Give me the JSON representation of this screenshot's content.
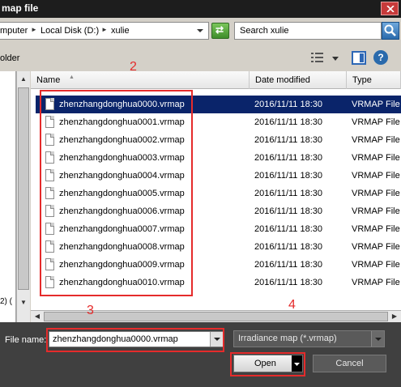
{
  "window": {
    "title": "map file"
  },
  "address": {
    "crumbs": [
      "mputer",
      "Local Disk (D:)",
      "xulie"
    ],
    "search_placeholder": "Search xulie"
  },
  "toolbar": {
    "left_label": "older"
  },
  "left_pane": {
    "fragment": "2) ("
  },
  "columns": {
    "name": "Name",
    "date": "Date modified",
    "type": "Type"
  },
  "files": [
    {
      "name": "zhenzhangdonghua0000.vrmap",
      "date": "2016/11/11 18:30",
      "type": "VRMAP File"
    },
    {
      "name": "zhenzhangdonghua0001.vrmap",
      "date": "2016/11/11 18:30",
      "type": "VRMAP File"
    },
    {
      "name": "zhenzhangdonghua0002.vrmap",
      "date": "2016/11/11 18:30",
      "type": "VRMAP File"
    },
    {
      "name": "zhenzhangdonghua0003.vrmap",
      "date": "2016/11/11 18:30",
      "type": "VRMAP File"
    },
    {
      "name": "zhenzhangdonghua0004.vrmap",
      "date": "2016/11/11 18:30",
      "type": "VRMAP File"
    },
    {
      "name": "zhenzhangdonghua0005.vrmap",
      "date": "2016/11/11 18:30",
      "type": "VRMAP File"
    },
    {
      "name": "zhenzhangdonghua0006.vrmap",
      "date": "2016/11/11 18:30",
      "type": "VRMAP File"
    },
    {
      "name": "zhenzhangdonghua0007.vrmap",
      "date": "2016/11/11 18:30",
      "type": "VRMAP File"
    },
    {
      "name": "zhenzhangdonghua0008.vrmap",
      "date": "2016/11/11 18:30",
      "type": "VRMAP File"
    },
    {
      "name": "zhenzhangdonghua0009.vrmap",
      "date": "2016/11/11 18:30",
      "type": "VRMAP File"
    },
    {
      "name": "zhenzhangdonghua0010.vrmap",
      "date": "2016/11/11 18:30",
      "type": "VRMAP File"
    }
  ],
  "footer": {
    "file_name_label": "File name:",
    "file_name_value": "zhenzhangdonghua0000.vrmap",
    "filter": "Irradiance map (*.vrmap)",
    "open_label": "Open",
    "cancel_label": "Cancel"
  },
  "annotations": {
    "a2": "2",
    "a3": "3",
    "a4": "4"
  },
  "colors": {
    "selection": "#0a246a",
    "annotation": "#e52b2b",
    "dialog_bg": "#d4d0c8",
    "footer_bg": "#404040"
  }
}
